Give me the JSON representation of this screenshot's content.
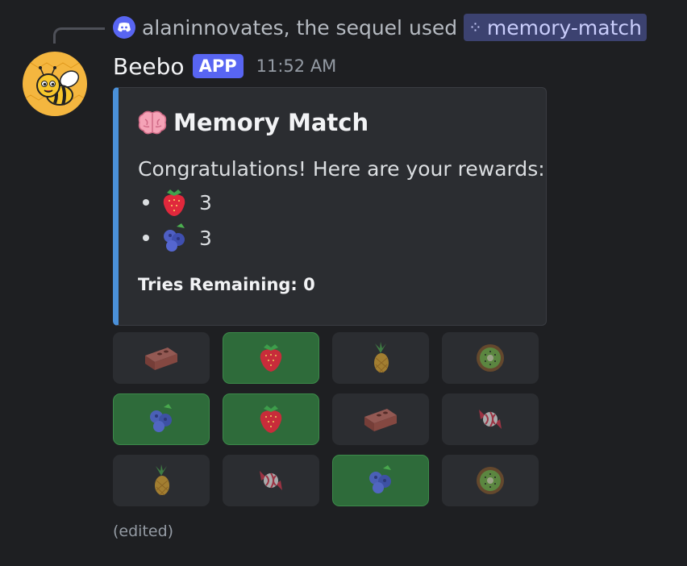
{
  "reply": {
    "user": "alaninnovates, the sequel",
    "action": "used",
    "command": "memory-match"
  },
  "message": {
    "username": "Beebo",
    "badge": "APP",
    "timestamp": "11:52 AM",
    "edited_label": "(edited)"
  },
  "embed": {
    "accent_color": "#4a90d9",
    "title_icon": "brain-emoji",
    "title": "Memory Match",
    "description": "Congratulations! Here are your rewards:",
    "rewards": [
      {
        "icon": "strawberry-emoji",
        "count": "3"
      },
      {
        "icon": "blueberries-emoji",
        "count": "3"
      }
    ],
    "tries": "Tries Remaining: 0"
  },
  "tiles": [
    {
      "icon": "brick-icon",
      "matched": false
    },
    {
      "icon": "strawberry-icon",
      "matched": true
    },
    {
      "icon": "pineapple-icon",
      "matched": false
    },
    {
      "icon": "kiwi-icon",
      "matched": false
    },
    {
      "icon": "blueberries-icon",
      "matched": true
    },
    {
      "icon": "strawberry-icon",
      "matched": true
    },
    {
      "icon": "brick-icon",
      "matched": false
    },
    {
      "icon": "candy-icon",
      "matched": false
    },
    {
      "icon": "pineapple-icon",
      "matched": false
    },
    {
      "icon": "candy-icon",
      "matched": false
    },
    {
      "icon": "blueberries-icon",
      "matched": true
    },
    {
      "icon": "kiwi-icon",
      "matched": false
    }
  ],
  "colors": {
    "matched_tile": "#2e6b3a",
    "unmatched_tile": "#2b2d31",
    "app_badge": "#5865f2"
  }
}
